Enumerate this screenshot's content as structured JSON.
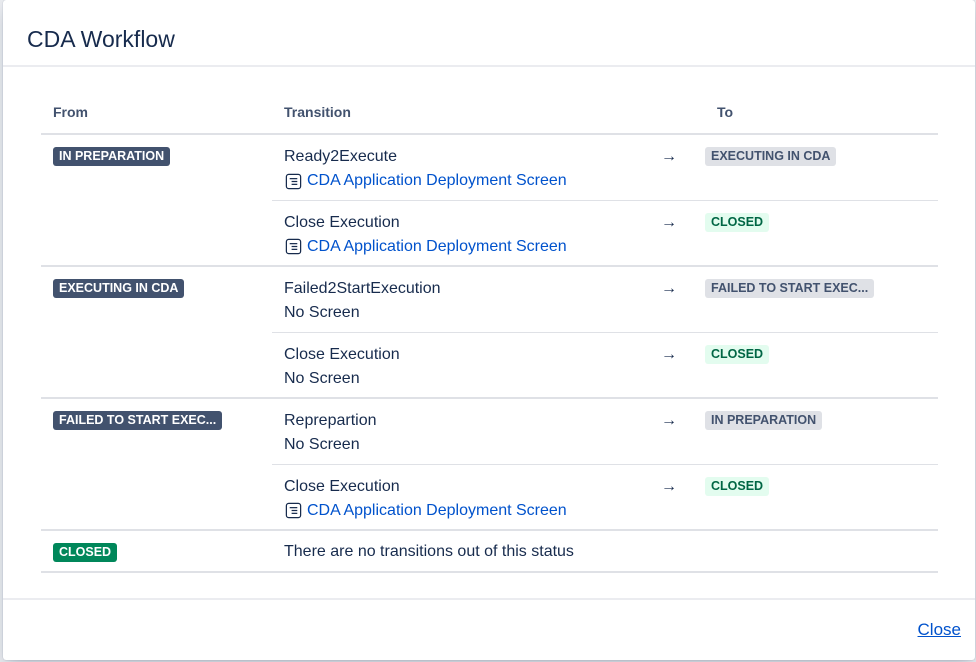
{
  "dialog": {
    "title": "CDA Workflow",
    "close_label": "Close"
  },
  "table": {
    "headers": {
      "from": "From",
      "transition": "Transition",
      "to": "To"
    },
    "groups": [
      {
        "from": "IN PREPARATION",
        "transitions": [
          {
            "name": "Ready2Execute",
            "screen": "CDA Application Deployment Screen",
            "has_screen": true,
            "arrow": "→",
            "to": "EXECUTING IN CDA"
          },
          {
            "name": "Close Execution",
            "screen": "CDA Application Deployment Screen",
            "has_screen": true,
            "arrow": "→",
            "to": "CLOSED"
          }
        ]
      },
      {
        "from": "EXECUTING IN CDA",
        "transitions": [
          {
            "name": "Failed2StartExecution",
            "screen": "No Screen",
            "has_screen": false,
            "arrow": "→",
            "to": "FAILED TO START EXEC..."
          },
          {
            "name": "Close Execution",
            "screen": "No Screen",
            "has_screen": false,
            "arrow": "→",
            "to": "CLOSED"
          }
        ]
      },
      {
        "from": "FAILED TO START EXEC...",
        "transitions": [
          {
            "name": "Reprepartion",
            "screen": "No Screen",
            "has_screen": false,
            "arrow": "→",
            "to": "IN PREPARATION"
          },
          {
            "name": "Close Execution",
            "screen": "CDA Application Deployment Screen",
            "has_screen": true,
            "arrow": "→",
            "to": "CLOSED"
          }
        ]
      }
    ],
    "final": {
      "from": "CLOSED",
      "message": "There are no transitions out of this status"
    }
  },
  "colors": {
    "dark_lozenge": "#42526e",
    "done_lozenge": "#00875a",
    "grey_lozenge": "#dfe1e6",
    "light_green_lozenge": "#e3fcef",
    "link": "#0052cc"
  }
}
